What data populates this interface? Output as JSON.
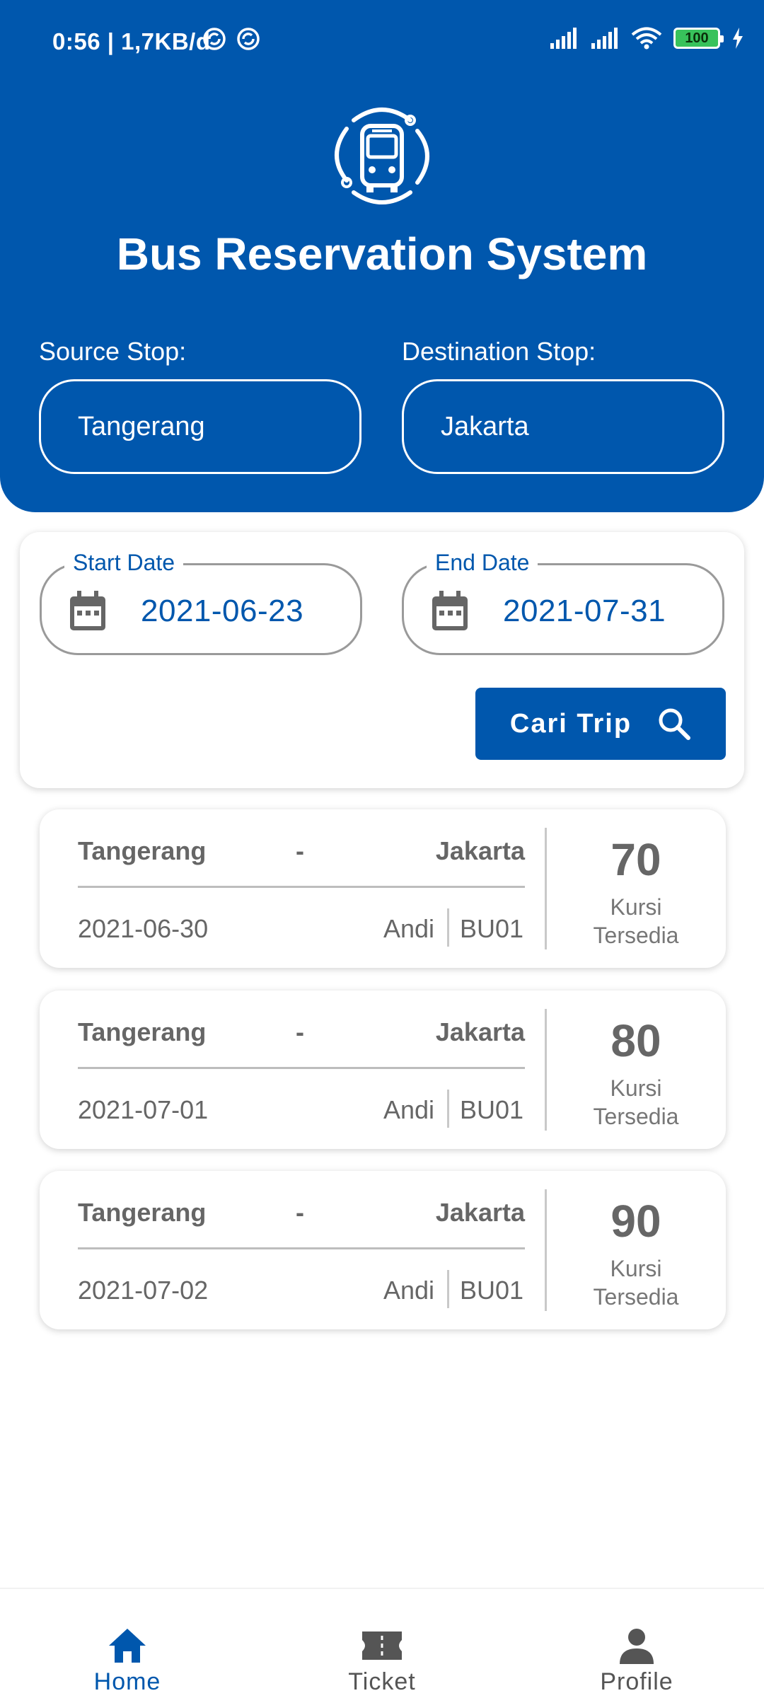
{
  "status_bar": {
    "time": "0:56 | 1,7KB/d",
    "battery": "100"
  },
  "app": {
    "title": "Bus Reservation System"
  },
  "route": {
    "source_label": "Source Stop:",
    "source_value": "Tangerang",
    "destination_label": "Destination Stop:",
    "destination_value": "Jakarta"
  },
  "search": {
    "start_label": "Start Date",
    "start_value": "2021-06-23",
    "end_label": "End Date",
    "end_value": "2021-07-31",
    "button_label": "Cari Trip"
  },
  "trips": [
    {
      "source": "Tangerang",
      "dash": "-",
      "destination": "Jakarta",
      "date": "2021-06-30",
      "driver": "Andi",
      "bus": "BU01",
      "seats": "70",
      "seats_label_1": "Kursi",
      "seats_label_2": "Tersedia"
    },
    {
      "source": "Tangerang",
      "dash": "-",
      "destination": "Jakarta",
      "date": "2021-07-01",
      "driver": "Andi",
      "bus": "BU01",
      "seats": "80",
      "seats_label_1": "Kursi",
      "seats_label_2": "Tersedia"
    },
    {
      "source": "Tangerang",
      "dash": "-",
      "destination": "Jakarta",
      "date": "2021-07-02",
      "driver": "Andi",
      "bus": "BU01",
      "seats": "90",
      "seats_label_1": "Kursi",
      "seats_label_2": "Tersedia"
    }
  ],
  "nav": {
    "items": [
      {
        "label": "Home",
        "icon": "home-icon"
      },
      {
        "label": "Ticket",
        "icon": "ticket-icon"
      },
      {
        "label": "Profile",
        "icon": "person-icon"
      }
    ],
    "active": "Home"
  },
  "colors": {
    "primary": "#0057AD",
    "text_gray": "#666666",
    "white": "#ffffff"
  }
}
